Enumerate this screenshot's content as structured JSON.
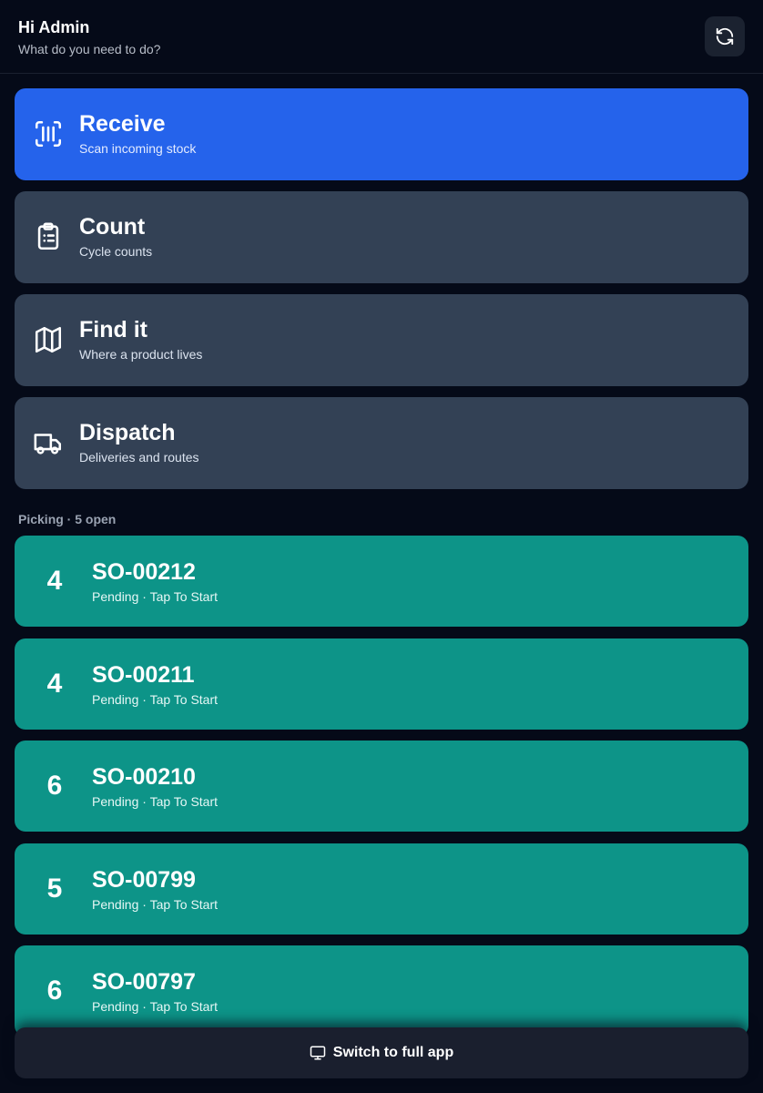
{
  "header": {
    "greeting": "Hi Admin",
    "subtitle": "What do you need to do?",
    "refresh_icon": "refresh-icon"
  },
  "actions": [
    {
      "title": "Receive",
      "subtitle": "Scan incoming stock",
      "icon": "barcode-scan-icon",
      "color": "#2563eb"
    },
    {
      "title": "Count",
      "subtitle": "Cycle counts",
      "icon": "clipboard-list-icon",
      "color": "#334155"
    },
    {
      "title": "Find it",
      "subtitle": "Where a product lives",
      "icon": "map-icon",
      "color": "#334155"
    },
    {
      "title": "Dispatch",
      "subtitle": "Deliveries and routes",
      "icon": "truck-icon",
      "color": "#334155"
    }
  ],
  "picking": {
    "label": "Picking · 5 open",
    "orders": [
      {
        "count": "4",
        "id": "SO-00212",
        "status": "Pending · Tap To Start"
      },
      {
        "count": "4",
        "id": "SO-00211",
        "status": "Pending · Tap To Start"
      },
      {
        "count": "6",
        "id": "SO-00210",
        "status": "Pending · Tap To Start"
      },
      {
        "count": "5",
        "id": "SO-00799",
        "status": "Pending · Tap To Start"
      },
      {
        "count": "6",
        "id": "SO-00797",
        "status": "Pending · Tap To Start"
      }
    ],
    "order_color": "#0d9488"
  },
  "footer": {
    "switch_label": "Switch to full app",
    "icon": "monitor-icon"
  }
}
